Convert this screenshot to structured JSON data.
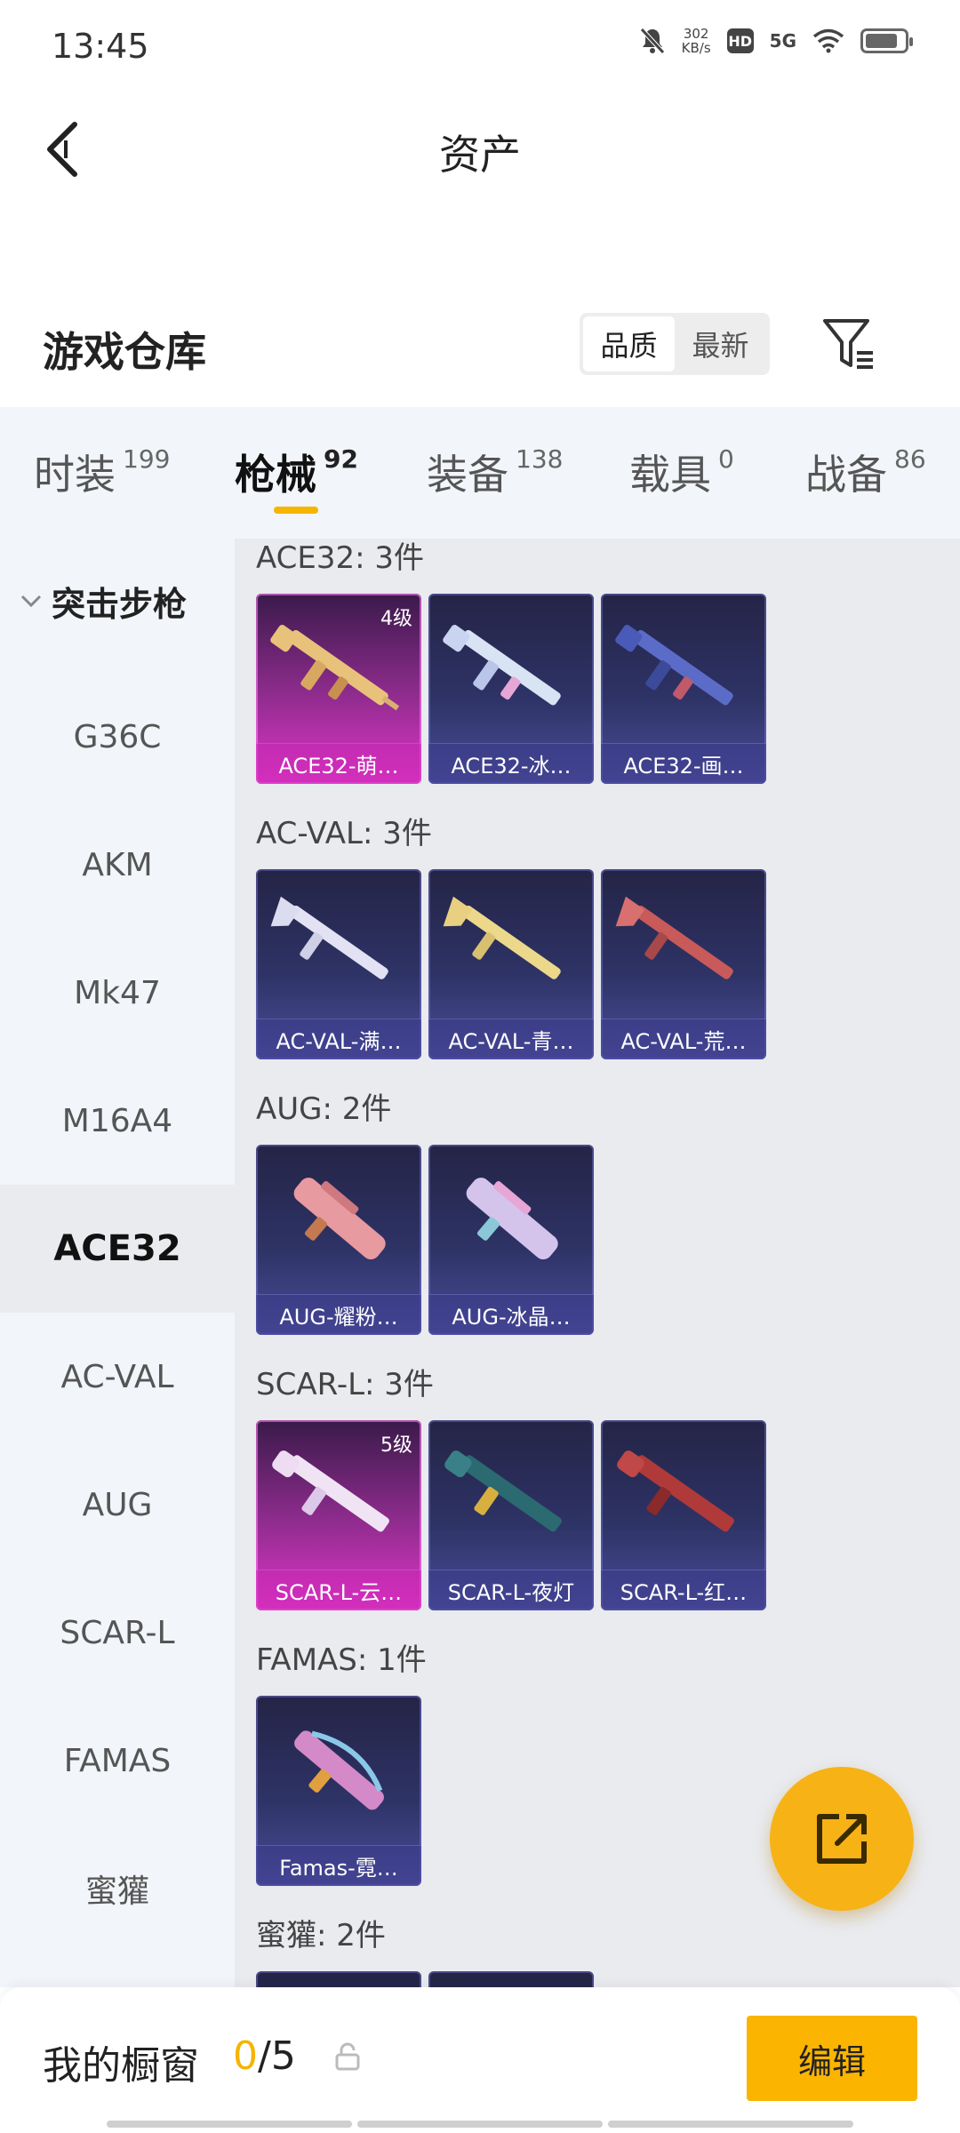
{
  "status_bar": {
    "time": "13:45",
    "speed_value": "302",
    "speed_unit": "KB/s",
    "hd": "HD",
    "network": "5G",
    "icons": [
      "mute-icon",
      "hd-icon",
      "signal-5g-icon",
      "wifi-icon",
      "battery-icon"
    ]
  },
  "header": {
    "title": "资产"
  },
  "section": {
    "title": "游戏仓库",
    "sort": {
      "options": [
        "品质",
        "最新"
      ],
      "selected": "品质"
    }
  },
  "tabs": [
    {
      "label": "时装",
      "count": "199"
    },
    {
      "label": "枪械",
      "count": "92",
      "active": true
    },
    {
      "label": "装备",
      "count": "138"
    },
    {
      "label": "载具",
      "count": "0"
    },
    {
      "label": "战备",
      "count": "86"
    }
  ],
  "sidebar": {
    "group": "突击步枪",
    "items": [
      "G36C",
      "AKM",
      "Mk47",
      "M16A4",
      "ACE32",
      "AC-VAL",
      "AUG",
      "SCAR-L",
      "FAMAS",
      "蜜獾"
    ],
    "selected": "ACE32"
  },
  "groups": [
    {
      "title": "ACE32: 3件",
      "items": [
        {
          "name": "ACE32-萌…",
          "level": "4级",
          "rarity": "pink"
        },
        {
          "name": "ACE32-冰…"
        },
        {
          "name": "ACE32-画…"
        }
      ]
    },
    {
      "title": "AC-VAL: 3件",
      "items": [
        {
          "name": "AC-VAL-满…"
        },
        {
          "name": "AC-VAL-青…"
        },
        {
          "name": "AC-VAL-荒…"
        }
      ]
    },
    {
      "title": "AUG: 2件",
      "items": [
        {
          "name": "AUG-耀粉…"
        },
        {
          "name": "AUG-冰晶…"
        }
      ]
    },
    {
      "title": "SCAR-L: 3件",
      "items": [
        {
          "name": "SCAR-L-云…",
          "level": "5级",
          "rarity": "pink"
        },
        {
          "name": "SCAR-L-夜灯"
        },
        {
          "name": "SCAR-L-红…"
        }
      ]
    },
    {
      "title": "FAMAS: 1件",
      "items": [
        {
          "name": "Famas-霓…"
        }
      ]
    },
    {
      "title": "蜜獾: 2件",
      "items": []
    }
  ],
  "bottom_bar": {
    "label": "我的橱窗",
    "current": "0",
    "total": "/5",
    "edit_label": "编辑"
  },
  "colors": {
    "accent": "#f5b400",
    "rare_pink": "#e036c8",
    "card_blue": "#2e3366"
  }
}
